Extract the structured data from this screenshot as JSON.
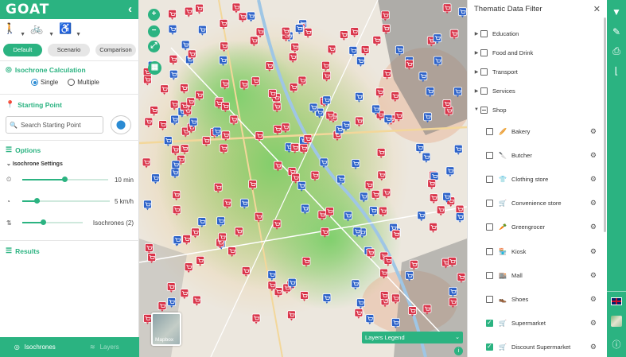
{
  "app": {
    "logo": "GOAT",
    "collapse_icon": "chevron-left-icon"
  },
  "colors": {
    "primary": "#2bb381",
    "marker_red": "#d9354a",
    "marker_blue": "#2e63c9",
    "link_blue": "#2b8bd3"
  },
  "travel_modes": [
    {
      "name": "walking",
      "icon": "walking-icon",
      "active": true
    },
    {
      "name": "cycling",
      "icon": "bicycle-icon",
      "active": false
    },
    {
      "name": "wheelchair",
      "icon": "wheelchair-icon",
      "active": false
    }
  ],
  "scenario_tabs": [
    {
      "label": "Default",
      "active": true
    },
    {
      "label": "Scenario",
      "active": false
    },
    {
      "label": "Comparison",
      "active": false
    }
  ],
  "isochrone_calc": {
    "title": "Isochrone Calculation",
    "single_label": "Single",
    "multiple_label": "Multiple",
    "selected": "Single"
  },
  "starting_point": {
    "title": "Starting Point",
    "search_placeholder": "Search Starting Point"
  },
  "options": {
    "title": "Options",
    "settings_title": "Isochrone Settings",
    "sliders": [
      {
        "name": "time",
        "icon": "clock-icon",
        "value_label": "10 min",
        "fraction": 0.5
      },
      {
        "name": "speed",
        "icon": "speedometer-icon",
        "value_label": "5 km/h",
        "fraction": 0.2
      },
      {
        "name": "isochrones",
        "icon": "sort-icon",
        "value_label": "Isochrones (2)",
        "fraction": 0.33
      }
    ]
  },
  "results": {
    "title": "Results"
  },
  "bottom_tabs": [
    {
      "label": "Isochrones",
      "icon": "isochrone-icon",
      "active": true
    },
    {
      "label": "Layers",
      "icon": "layers-icon",
      "active": false
    }
  ],
  "map": {
    "basemap_label": "Mapbox",
    "legend_label": "Layers Legend",
    "controls": [
      "zoom-in",
      "zoom-out",
      "fullscreen",
      "map-layers"
    ]
  },
  "filter": {
    "title": "Thematic Data Filter",
    "categories": [
      {
        "label": "Education",
        "expanded": false,
        "state": "off"
      },
      {
        "label": "Food and Drink",
        "expanded": false,
        "state": "off"
      },
      {
        "label": "Transport",
        "expanded": false,
        "state": "off"
      },
      {
        "label": "Services",
        "expanded": false,
        "state": "off"
      },
      {
        "label": "Shop",
        "expanded": true,
        "state": "partial"
      }
    ],
    "shop_items": [
      {
        "label": "Bakery",
        "icon": "bread-icon",
        "checked": false
      },
      {
        "label": "Butcher",
        "icon": "knife-icon",
        "checked": false
      },
      {
        "label": "Clothing store",
        "icon": "shirt-icon",
        "checked": false
      },
      {
        "label": "Convenience store",
        "icon": "cart-icon",
        "checked": false
      },
      {
        "label": "Greengrocer",
        "icon": "vegetable-icon",
        "checked": false
      },
      {
        "label": "Kiosk",
        "icon": "kiosk-icon",
        "checked": false
      },
      {
        "label": "Mall",
        "icon": "mall-icon",
        "checked": false
      },
      {
        "label": "Shoes",
        "icon": "shoe-icon",
        "checked": false
      },
      {
        "label": "Supermarket",
        "icon": "cart-icon",
        "checked": true
      },
      {
        "label": "Discount Supermarket",
        "icon": "cart-icon",
        "checked": true
      }
    ]
  },
  "right_toolbar": [
    "filter-icon",
    "edit-icon",
    "print-icon",
    "measure-icon",
    "language-flag-icon",
    "basemap-icon",
    "info-icon"
  ]
}
